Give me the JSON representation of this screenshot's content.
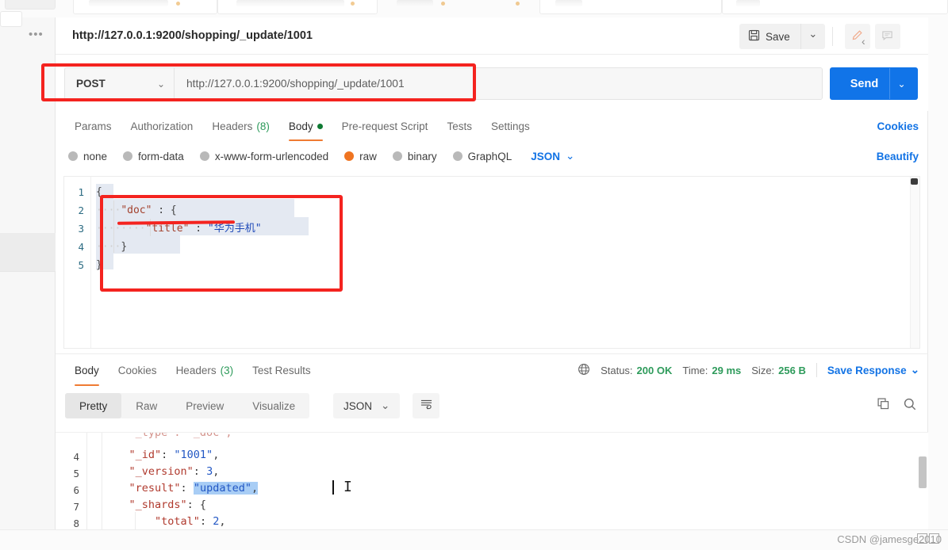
{
  "app": {
    "request_title": "http://127.0.0.1:9200/shopping/_update/1001",
    "sidebar_dots": "•••"
  },
  "toolbar": {
    "save_label": "Save",
    "save_icon": "floppy-disk-icon",
    "save_caret": "⌄",
    "edit_icon": "pencil-icon",
    "comment_icon": "comment-icon",
    "collapse_icon": "‹"
  },
  "url_bar": {
    "method": "POST",
    "method_caret": "⌄",
    "url": "http://127.0.0.1:9200/shopping/_update/1001",
    "send_label": "Send",
    "send_caret": "⌄"
  },
  "request_tabs": {
    "items": [
      {
        "label": "Params",
        "active": false
      },
      {
        "label": "Authorization",
        "active": false
      },
      {
        "label": "Headers",
        "count": "(8)",
        "active": false
      },
      {
        "label": "Body",
        "dot": true,
        "active": true
      },
      {
        "label": "Pre-request Script",
        "active": false
      },
      {
        "label": "Tests",
        "active": false
      },
      {
        "label": "Settings",
        "active": false
      }
    ],
    "cookies_label": "Cookies"
  },
  "body_types": {
    "options": [
      {
        "label": "none",
        "selected": false
      },
      {
        "label": "form-data",
        "selected": false
      },
      {
        "label": "x-www-form-urlencoded",
        "selected": false
      },
      {
        "label": "raw",
        "selected": true
      },
      {
        "label": "binary",
        "selected": false
      },
      {
        "label": "GraphQL",
        "selected": false
      }
    ],
    "format": "JSON",
    "format_caret": "⌄",
    "beautify_label": "Beautify"
  },
  "request_body": {
    "line_numbers": [
      "1",
      "2",
      "3",
      "4",
      "5"
    ],
    "lines": [
      {
        "n": "1",
        "dots": "",
        "text": "{",
        "selected": true
      },
      {
        "n": "2",
        "dots": "····",
        "text": "\"doc\" : {",
        "selected": true
      },
      {
        "n": "3",
        "dots": "········",
        "text": "\"title\" : \"华为手机\"",
        "selected": true
      },
      {
        "n": "4",
        "dots": "····",
        "text": "}",
        "selected": true
      },
      {
        "n": "5",
        "dots": "",
        "text": "}",
        "selected": true
      }
    ],
    "raw_text": "{\n    \"doc\" : {\n        \"title\" : \"华为手机\"\n    }\n}"
  },
  "response_tabs": {
    "items": [
      {
        "label": "Body",
        "active": true
      },
      {
        "label": "Cookies",
        "active": false
      },
      {
        "label": "Headers",
        "count": "(3)",
        "active": false
      },
      {
        "label": "Test Results",
        "active": false
      }
    ]
  },
  "response_meta": {
    "globe_icon": "globe-icon",
    "status_label": "Status:",
    "status_value": "200 OK",
    "time_label": "Time:",
    "time_value": "29 ms",
    "size_label": "Size:",
    "size_value": "256 B",
    "save_response_label": "Save Response",
    "save_response_caret": "⌄"
  },
  "response_toolbar": {
    "views": [
      {
        "label": "Pretty",
        "active": true
      },
      {
        "label": "Raw",
        "active": false
      },
      {
        "label": "Preview",
        "active": false
      },
      {
        "label": "Visualize",
        "active": false
      }
    ],
    "format": "JSON",
    "format_caret": "⌄",
    "wrap_icon": "word-wrap-icon",
    "copy_icon": "copy-icon",
    "search_icon": "search-icon"
  },
  "response_body": {
    "lines": [
      {
        "n": "4",
        "indent": "    ",
        "key": "\"_id\"",
        "sep": ": ",
        "value": "\"1001\"",
        "tail": ","
      },
      {
        "n": "5",
        "indent": "    ",
        "key": "\"_version\"",
        "sep": ": ",
        "value": "3",
        "tail": ","
      },
      {
        "n": "6",
        "indent": "    ",
        "key": "\"result\"",
        "sep": ": ",
        "value": "\"updated\"",
        "tail": ",",
        "highlight": true
      },
      {
        "n": "7",
        "indent": "    ",
        "key": "\"_shards\"",
        "sep": ": ",
        "value": "{",
        "tail": ""
      },
      {
        "n": "8",
        "indent": "        ",
        "key": "\"total\"",
        "sep": ": ",
        "value": "2",
        "tail": ","
      }
    ]
  },
  "watermark": {
    "text": "CSDN @jamesge2010"
  },
  "colors": {
    "accent_orange": "#ef7b32",
    "link_blue": "#1273e5",
    "send_blue": "#1174e8",
    "status_green": "#2e9b5b",
    "annotation_red": "#f4231f"
  }
}
